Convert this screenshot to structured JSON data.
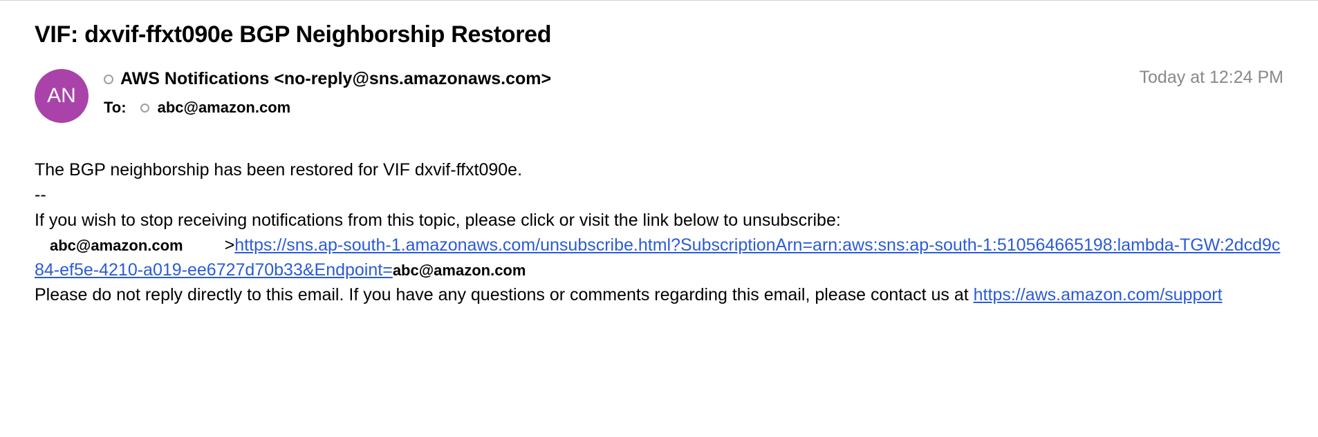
{
  "subject": "VIF: dxvif-ffxt090e BGP Neighborship Restored",
  "avatar_initials": "AN",
  "from": "AWS Notifications <no-reply@sns.amazonaws.com>",
  "to_label": "To:",
  "to_email": "abc@amazon.com",
  "timestamp": "Today at 12:24 PM",
  "body": {
    "line1": "The BGP neighborship has been restored for VIF dxvif-ffxt090e.",
    "dashes": "--",
    "unsubscribe_intro": "If you wish to stop receiving notifications from this topic, please click or visit the link below to unsubscribe:",
    "unsub_email": "abc@amazon.com",
    "gt": ">",
    "unsub_link_text": "https://sns.ap-south-1.amazonaws.com/unsubscribe.html?SubscriptionArn=arn:aws:sns:ap-south-1:510564665198:lambda-TGW:2dcd9c84-ef5e-4210-a019-ee6727d70b33&Endpoint=",
    "endpoint_email": "abc@amazon.com",
    "footer": "Please do not reply directly to this email. If you have any questions or comments regarding this email, please contact us at ",
    "support_link": "https://aws.amazon.com/support"
  }
}
